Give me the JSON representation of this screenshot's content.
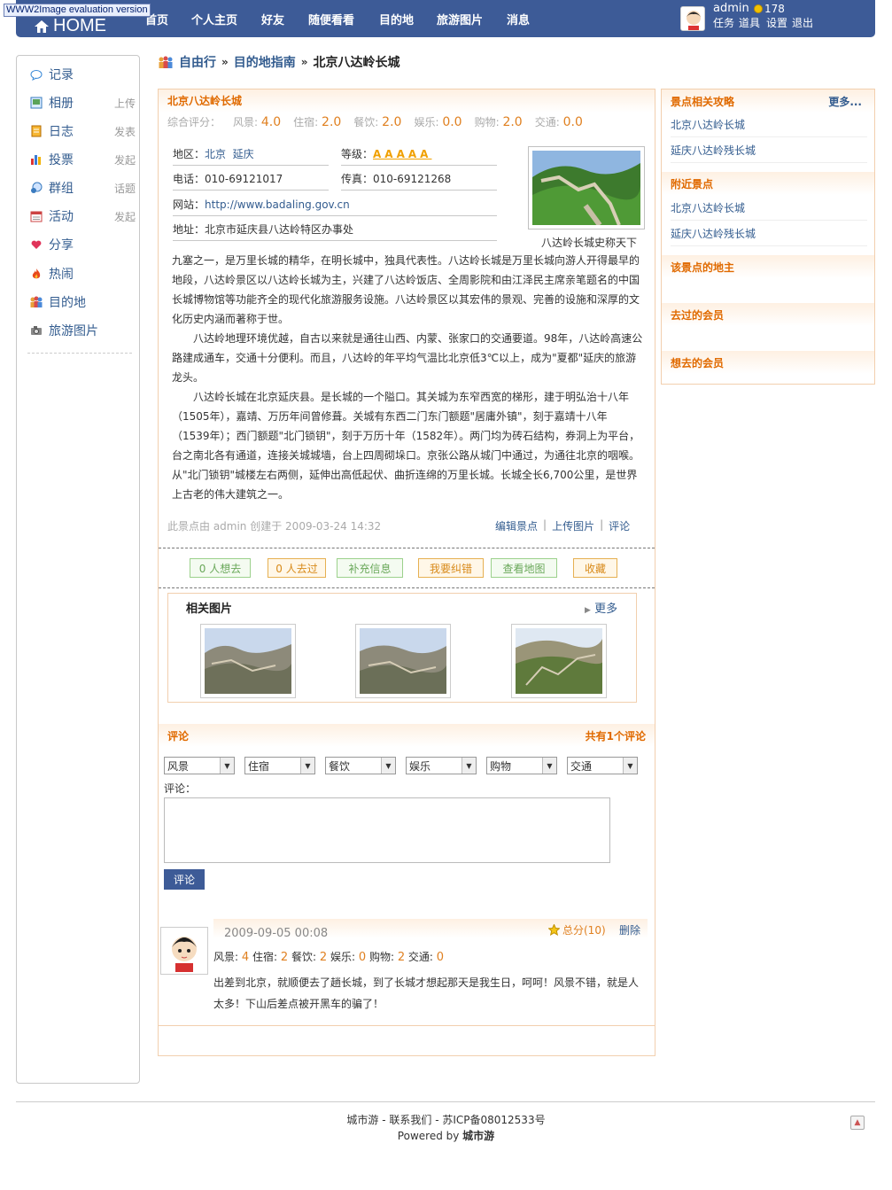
{
  "watermark": "WWW2Image evaluation version",
  "top": {
    "home": "HOME",
    "nav": [
      "首页",
      "个人主页",
      "好友",
      "随便看看",
      "目的地",
      "旅游图片",
      "消息"
    ],
    "user": "admin",
    "coins": "178",
    "links": [
      "任务",
      "道具",
      "设置",
      "退出"
    ]
  },
  "sidebar": {
    "items": [
      {
        "label": "记录",
        "action": "",
        "icon": "speech-bubble-icon"
      },
      {
        "label": "相册",
        "action": "上传",
        "icon": "photo-album-icon"
      },
      {
        "label": "日志",
        "action": "发表",
        "icon": "notebook-icon"
      },
      {
        "label": "投票",
        "action": "发起",
        "icon": "bar-chart-icon"
      },
      {
        "label": "群组",
        "action": "话题",
        "icon": "group-icon"
      },
      {
        "label": "活动",
        "action": "发起",
        "icon": "calendar-icon"
      },
      {
        "label": "分享",
        "action": "",
        "icon": "hearts-icon"
      },
      {
        "label": "热闹",
        "action": "",
        "icon": "fire-icon"
      },
      {
        "label": "目的地",
        "action": "",
        "icon": "people-icon"
      },
      {
        "label": "旅游图片",
        "action": "",
        "icon": "camera-icon"
      }
    ]
  },
  "breadcrumb": [
    "自由行",
    "目的地指南",
    "北京八达岭长城"
  ],
  "spot": {
    "title": "北京八达岭长城",
    "ratings": [
      {
        "label": "综合评分：",
        "value": ""
      },
      {
        "label": "风景:",
        "value": "4.0"
      },
      {
        "label": "住宿:",
        "value": "2.0"
      },
      {
        "label": "餐饮:",
        "value": "2.0"
      },
      {
        "label": "娱乐:",
        "value": "0.0"
      },
      {
        "label": "购物:",
        "value": "2.0"
      },
      {
        "label": "交通:",
        "value": "0.0"
      }
    ],
    "region_label": "地区：",
    "region1": "北京",
    "region2": "延庆",
    "grade_label": "等级：",
    "grade_stars": "AAAAA",
    "phone": "电话：010-69121017",
    "fax": "传真：010-69121268",
    "site_label": "网站：",
    "site": "http://www.badaling.gov.cn",
    "address": "地址：北京市延庆县八达岭特区办事处",
    "photo_caption": "八达岭长城史称天下",
    "para1": "九塞之一，是万里长城的精华，在明长城中，独具代表性。八达岭长城是万里长城向游人开得最早的地段，八达岭景区以八达岭长城为主，兴建了八达岭饭店、全周影院和由江泽民主席亲笔题名的中国长城博物馆等功能齐全的现代化旅游服务设施。八达岭景区以其宏伟的景观、完善的设施和深厚的文化历史内涵而著称于世。",
    "para2": "八达岭地理环境优越，自古以来就是通往山西、内蒙、张家口的交通要道。98年，八达岭高速公路建成通车，交通十分便利。而且，八达岭的年平均气温比北京低3℃以上，成为\"夏都\"延庆的旅游龙头。",
    "para3": "八达岭长城在北京延庆县。是长城的一个隘口。其关城为东窄西宽的梯形，建于明弘治十八年（1505年），嘉靖、万历年间曾修葺。关城有东西二门东门额题\"居庸外镇\"，刻于嘉靖十八年（1539年）；西门额题\"北门锁钥\"，刻于万历十年（1582年）。两门均为砖石结构，券洞上为平台，台之南北各有通道，连接关城城墙，台上四周砌垛口。京张公路从城门中通过，为通往北京的咽喉。从\"北门锁钥\"城楼左右两侧，延伸出高低起伏、曲折连绵的万里长城。长城全长6,700公里，是世界上古老的伟大建筑之一。",
    "meta": "此景点由  admin 创建于  2009-03-24 14:32",
    "links": [
      "编辑景点",
      "上传图片",
      "评论"
    ]
  },
  "actions": [
    "0 人想去",
    "0 人去过",
    "补充信息",
    "我要纠错",
    "查看地图",
    "收藏"
  ],
  "related": {
    "title": "相关图片",
    "more": "更多"
  },
  "comment": {
    "title": "评论",
    "count": "共有1个评论",
    "selects": [
      "风景",
      "住宿",
      "餐饮",
      "娱乐",
      "购物",
      "交通"
    ],
    "label": "评论：",
    "submit": "评论",
    "item": {
      "date": "2009-09-05 00:08",
      "score": "总分(10)",
      "delete": "删除",
      "ratings": [
        {
          "label": "风景:",
          "value": "4"
        },
        {
          "label": "住宿:",
          "value": "2"
        },
        {
          "label": "餐饮:",
          "value": "2"
        },
        {
          "label": "娱乐:",
          "value": "0"
        },
        {
          "label": "购物:",
          "value": "2"
        },
        {
          "label": "交通:",
          "value": "0"
        }
      ],
      "text": "出差到北京，就顺便去了趟长城，到了长城才想起那天是我生日，呵呵！风景不错，就是人太多！下山后差点被开黑车的骗了！"
    }
  },
  "right": {
    "guides_title": "景点相关攻略",
    "guides_more": "更多...",
    "guides": [
      "北京八达岭长城",
      "延庆八达岭残长城"
    ],
    "nearby_title": "附近景点",
    "nearby": [
      "北京八达岭长城",
      "延庆八达岭残长城"
    ],
    "owner_title": "该景点的地主",
    "visited_title": "去过的会员",
    "want_title": "想去的会员"
  },
  "footer": {
    "line1": "城市游 - 联系我们 - 苏ICP备08012533号",
    "powered": "Powered by ",
    "brand": "城市游"
  }
}
